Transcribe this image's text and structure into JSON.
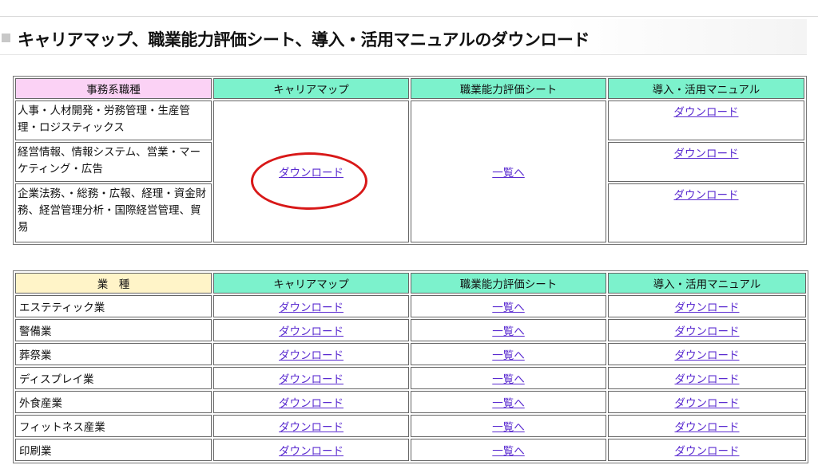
{
  "heading": "キャリアマップ、職業能力評価シート、導入・活用マニュアルのダウンロード",
  "table1": {
    "headers": [
      "事務系職種",
      "キャリアマップ",
      "職業能力評価シート",
      "導入・活用マニュアル"
    ],
    "rows": [
      "人事・人材開発・労務管理・生産管理・ロジスティックス",
      "経営情報、情報システム、営業・マーケティング・広告",
      "企業法務、・総務・広報、経理・資金財務、経営管理分析・国際経営管理、貿易"
    ],
    "career_map_link": "ダウンロード",
    "eval_sheet_link": "一覧へ",
    "manual_links": [
      "ダウンロード",
      "ダウンロード",
      "ダウンロード"
    ]
  },
  "table2": {
    "headers": [
      "業　種",
      "キャリアマップ",
      "職業能力評価シート",
      "導入・活用マニュアル"
    ],
    "rows": [
      {
        "name": "エステティック業",
        "map": "ダウンロード",
        "sheet": "一覧へ",
        "manual": "ダウンロード"
      },
      {
        "name": "警備業",
        "map": "ダウンロード",
        "sheet": "一覧へ",
        "manual": "ダウンロード"
      },
      {
        "name": "葬祭業",
        "map": "ダウンロード",
        "sheet": "一覧へ",
        "manual": "ダウンロード"
      },
      {
        "name": "ディスプレイ業",
        "map": "ダウンロード",
        "sheet": "一覧へ",
        "manual": "ダウンロード"
      },
      {
        "name": "外食産業",
        "map": "ダウンロード",
        "sheet": "一覧へ",
        "manual": "ダウンロード"
      },
      {
        "name": "フィットネス産業",
        "map": "ダウンロード",
        "sheet": "一覧へ",
        "manual": "ダウンロード"
      },
      {
        "name": "印刷業",
        "map": "ダウンロード",
        "sheet": "一覧へ",
        "manual": "ダウンロード"
      }
    ]
  },
  "colors": {
    "pink_header": "#fbd2f5",
    "green_header": "#7cf2cc",
    "yellow_header": "#fff4c8",
    "link": "#5a2bd0",
    "highlight_ellipse": "#d81818"
  }
}
